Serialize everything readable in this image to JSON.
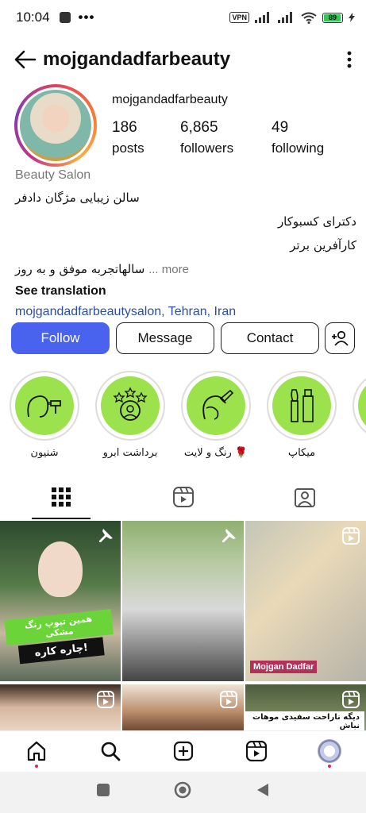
{
  "status_bar": {
    "time": "10:04",
    "dots": "•••",
    "vpn": "VPN",
    "battery": "89"
  },
  "header": {
    "title": "mojgandadfarbeauty"
  },
  "profile": {
    "username": "mojgandadfarbeauty",
    "stats": [
      {
        "value": "186",
        "label": "posts"
      },
      {
        "value": "6,865",
        "label": "followers"
      },
      {
        "value": "49",
        "label": "following"
      }
    ],
    "category": "Beauty Salon",
    "bio_lines": [
      "سالن زیبایی مژگان دادفر",
      "دکترای کسبوکار",
      "کارآفرین برتر"
    ],
    "bio_last_line": "سالهاتجربه موفق و به روز",
    "more": "... more",
    "see_translation": "See translation",
    "location": "mojgandadfarbeautysalon, Tehran, Iran"
  },
  "actions": {
    "follow": "Follow",
    "message": "Message",
    "contact": "Contact"
  },
  "highlights": [
    {
      "label": "شنیون",
      "icon": "hair-dryer-icon"
    },
    {
      "label": "برداشت ابرو",
      "icon": "face-stars-icon"
    },
    {
      "label": "رنگ و لایت 🌹",
      "icon": "hair-color-icon"
    },
    {
      "label": "میکاپ",
      "icon": "makeup-icon"
    }
  ],
  "tabs": [
    {
      "name": "grid-tab",
      "icon": "grid-icon"
    },
    {
      "name": "reels-tab",
      "icon": "reels-icon"
    },
    {
      "name": "tagged-tab",
      "icon": "tagged-icon"
    }
  ],
  "posts": {
    "post1_banner_top": "همین تیوپ رنگ مشکی",
    "post1_banner_bottom": "چاره کاره!",
    "post3_watermark": "Mojgan Dadfar",
    "post6_banner": "دیگه ناراحت سفیدی موهات نباش"
  },
  "colors": {
    "follow_button": "#4a63ee",
    "highlight_bg": "#9be24c",
    "link": "#2b4f9e"
  }
}
